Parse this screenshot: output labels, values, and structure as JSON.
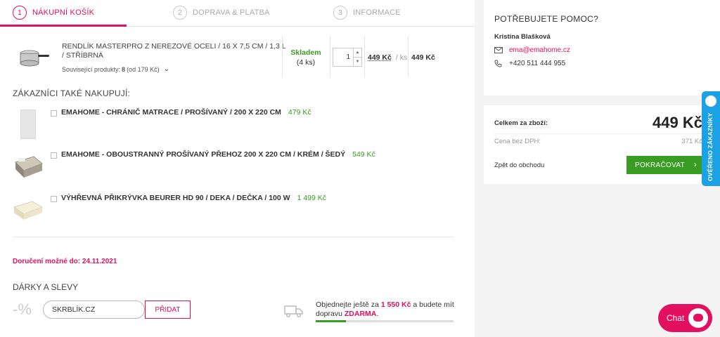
{
  "steps": [
    {
      "num": "1",
      "label": "NÁKUPNÍ KOŠÍK"
    },
    {
      "num": "2",
      "label": "DOPRAVA & PLATBA"
    },
    {
      "num": "3",
      "label": "INFORMACE"
    }
  ],
  "cart_item": {
    "name": "RENDLÍK MASTERPRO Z NEREZOVÉ OCELI / 16 X 7,5 CM / 1,3 L / STŘÍBRNÁ",
    "related_label": "Související produkty:",
    "related_count": "8",
    "related_from": "(od 179 Kč)",
    "stock_status": "Skladem",
    "stock_count": "(4 ks)",
    "quantity": "1",
    "unit_price": "449 Kč",
    "per_unit": "/ ks",
    "total_price": "449 Kč"
  },
  "also_bought": {
    "title": "ZÁKAZNÍCI TAKÉ NAKUPUJÍ:",
    "items": [
      {
        "name": "EMAHOME - CHRÁNIČ MATRACE / PROŠÍVANÝ / 200 X 220 CM",
        "price": "479 Kč"
      },
      {
        "name": "EMAHOME - OBOUSTRANNÝ PROŠÍVANÝ PŘEHOZ 200 X 220 CM / KRÉM / ŠEDÝ",
        "price": "549 Kč"
      },
      {
        "name": "VÝHŘEVNÁ PŘIKRÝVKA BEURER HD 90 / DEKA / DEČKA / 100 W",
        "price": "1 499 Kč"
      }
    ]
  },
  "delivery": "Doručení možné do: 24.11.2021",
  "gifts": {
    "title": "DÁRKY A SLEVY",
    "percent_symbol": "-%",
    "coupon_value": "SKRBLÍK.CZ",
    "add_label": "PŘIDAT"
  },
  "free_shipping": {
    "text_before": "Objednejte ještě za",
    "amount": "1 550 Kč",
    "text_middle": "a budete mít dopravu",
    "free_word": "ZDARMA",
    "text_end": ".",
    "progress": 0.22
  },
  "help": {
    "title": "POTŘEBUJETE POMOC?",
    "name": "Kristína Blašková",
    "email": "ema@emahome.cz",
    "phone": "+420 511 444 955"
  },
  "summary": {
    "total_label": "Celkem za zboží:",
    "total_value": "449 Kč",
    "net_label": "Cena bez DPH:",
    "net_value": "371 Kč",
    "back_label": "Zpět do obchodu",
    "continue_label": "POKRAČOVAT"
  },
  "verified_badge": "OVĚŘENO ZÁKAZNÍKY",
  "chat_label": "Chat",
  "colors": {
    "accent": "#e2105f",
    "green": "#3a9d23",
    "badge": "#1aa1e6"
  }
}
